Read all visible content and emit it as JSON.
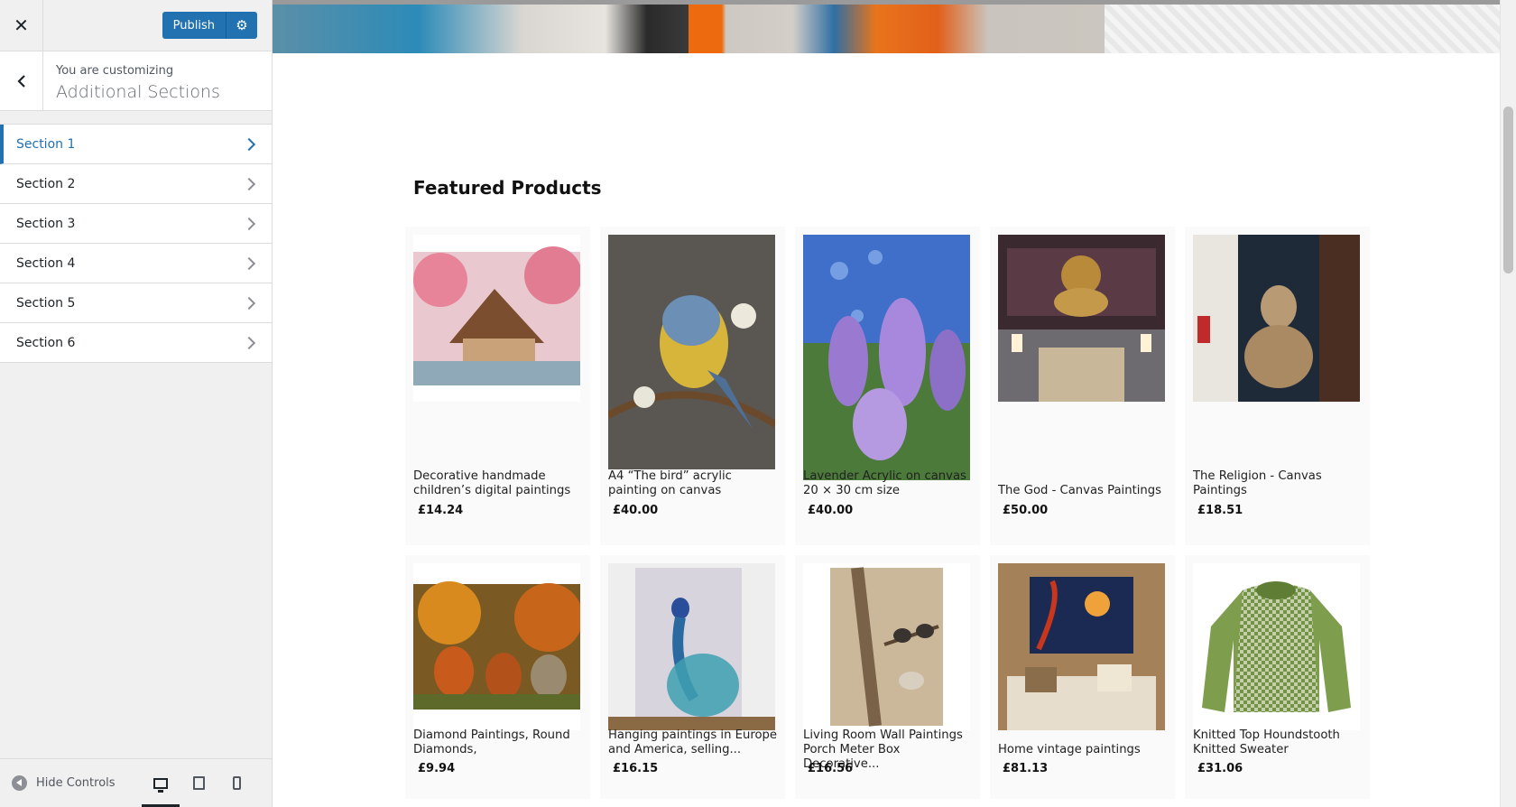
{
  "sidebar": {
    "close_icon": "close-icon",
    "publish_label": "Publish",
    "publish_settings_icon": "gear-icon",
    "back_icon": "chevron-left-icon",
    "customizing_label": "You are customizing",
    "customizing_title": "Additional Sections",
    "sections": [
      {
        "label": "Section 1",
        "active": true
      },
      {
        "label": "Section 2",
        "active": false
      },
      {
        "label": "Section 3",
        "active": false
      },
      {
        "label": "Section 4",
        "active": false
      },
      {
        "label": "Section 5",
        "active": false
      },
      {
        "label": "Section 6",
        "active": false
      }
    ],
    "footer": {
      "hide_controls_label": "Hide Controls",
      "devices": [
        "desktop-icon",
        "tablet-icon",
        "mobile-icon"
      ],
      "active_device": "desktop"
    }
  },
  "preview": {
    "featured_title": "Featured Products",
    "products": [
      {
        "name": "Decorative handmade children’s digital paintings",
        "price": "£14.24"
      },
      {
        "name": "A4 “The bird” acrylic painting on canvas",
        "price": "£40.00"
      },
      {
        "name": "Lavender Acrylic on canvas 20 × 30 cm size",
        "price": "£40.00"
      },
      {
        "name": "The God - Canvas Paintings",
        "price": "£50.00"
      },
      {
        "name": "The Religion - Canvas Paintings",
        "price": "£18.51"
      },
      {
        "name": "Diamond Paintings, Round Diamonds,",
        "price": "£9.94"
      },
      {
        "name": "Hanging paintings in Europe and America, selling...",
        "price": "£16.15"
      },
      {
        "name": "Living Room Wall Paintings Porch Meter Box Decorative...",
        "price": "£16.56"
      },
      {
        "name": "Home vintage paintings",
        "price": "£81.13"
      },
      {
        "name": "Knitted Top Houndstooth Knitted Sweater",
        "price": "£31.06"
      }
    ]
  },
  "colors": {
    "accent": "#2271b1",
    "sidebar_bg": "#f0f0f1"
  }
}
